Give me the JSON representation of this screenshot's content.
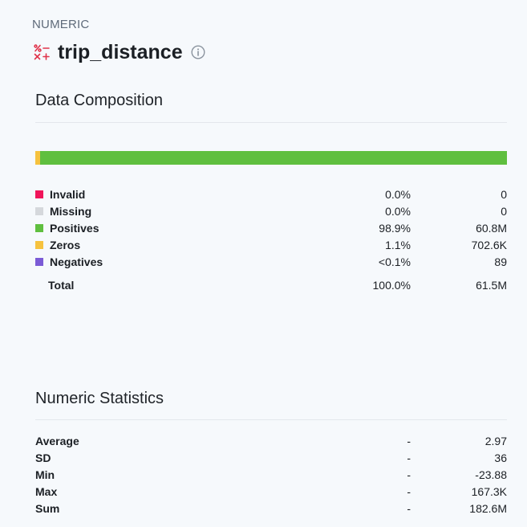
{
  "header": {
    "type_label": "NUMERIC",
    "title": "trip_distance",
    "type_icon": "numeric-type-icon",
    "info_icon": "info-icon"
  },
  "composition": {
    "title": "Data Composition",
    "bar": [
      {
        "name": "Invalid",
        "fraction": 0.0,
        "color": "#f0145a"
      },
      {
        "name": "Missing",
        "fraction": 0.0,
        "color": "#d5d8dc"
      },
      {
        "name": "Zeros",
        "fraction": 0.011,
        "color": "#f6c23e"
      },
      {
        "name": "Positives",
        "fraction": 0.989,
        "color": "#5fbf3f"
      },
      {
        "name": "Negatives",
        "fraction": 0.0,
        "color": "#7b5bd6"
      }
    ],
    "rows": [
      {
        "label": "Invalid",
        "percent": "0.0%",
        "count": "0",
        "color": "#f0145a"
      },
      {
        "label": "Missing",
        "percent": "0.0%",
        "count": "0",
        "color": "#d5d8dc"
      },
      {
        "label": "Positives",
        "percent": "98.9%",
        "count": "60.8M",
        "color": "#5fbf3f"
      },
      {
        "label": "Zeros",
        "percent": "1.1%",
        "count": "702.6K",
        "color": "#f6c23e"
      },
      {
        "label": "Negatives",
        "percent": "<0.1%",
        "count": "89",
        "color": "#7b5bd6"
      }
    ],
    "total": {
      "label": "Total",
      "percent": "100.0%",
      "count": "61.5M"
    }
  },
  "statistics": {
    "title": "Numeric Statistics",
    "rows": [
      {
        "label": "Average",
        "extra": "-",
        "value": "2.97"
      },
      {
        "label": "SD",
        "extra": "-",
        "value": "36"
      },
      {
        "label": "Min",
        "extra": "-",
        "value": "-23.88"
      },
      {
        "label": "Max",
        "extra": "-",
        "value": "167.3K"
      },
      {
        "label": "Sum",
        "extra": "-",
        "value": "182.6M"
      }
    ]
  }
}
